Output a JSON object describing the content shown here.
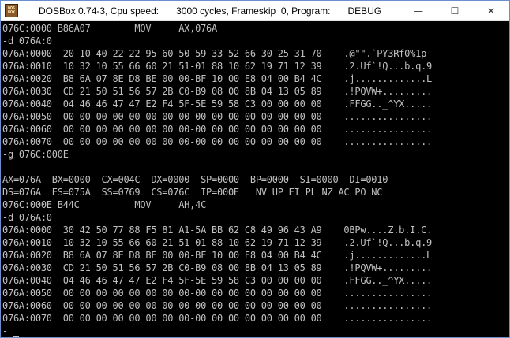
{
  "window": {
    "icon_label_top": "DOS",
    "icon_label_bottom": "BOX",
    "title_parts": [
      "DOSBox 0.74-3, Cpu speed:",
      "3000 cycles, Frameskip  0, Program:",
      "DEBUG"
    ],
    "controls": {
      "minimize": "—",
      "maximize": "☐",
      "close": "✕"
    }
  },
  "console": {
    "lines": [
      "076C:0000 B86A07        MOV     AX,076A",
      "-d 076A:0",
      "076A:0000  20 10 40 22 22 95 60 50-59 33 52 66 30 25 31 70    .@\"\".`PY3Rf0%1p",
      "076A:0010  10 32 10 55 66 60 21 51-01 88 10 62 19 71 12 39    .2.Uf`!Q...b.q.9",
      "076A:0020  B8 6A 07 8E D8 BE 00 00-BF 10 00 E8 04 00 B4 4C    .j.............L",
      "076A:0030  CD 21 50 51 56 57 2B C0-B9 08 00 8B 04 13 05 89    .!PQVW+.........",
      "076A:0040  04 46 46 47 47 E2 F4 5F-5E 59 58 C3 00 00 00 00    .FFGG.._^YX.....",
      "076A:0050  00 00 00 00 00 00 00 00-00 00 00 00 00 00 00 00    ................",
      "076A:0060  00 00 00 00 00 00 00 00-00 00 00 00 00 00 00 00    ................",
      "076A:0070  00 00 00 00 00 00 00 00-00 00 00 00 00 00 00 00    ................",
      "-g 076C:000E",
      "",
      "AX=076A  BX=0000  CX=004C  DX=0000  SP=0000  BP=0000  SI=0000  DI=0010",
      "DS=076A  ES=075A  SS=0769  CS=076C  IP=000E   NV UP EI PL NZ AC PO NC",
      "076C:000E B44C          MOV     AH,4C",
      "-d 076A:0",
      "076A:0000  30 42 50 77 88 F5 81 A1-5A BB 62 C8 49 96 43 A9    0BPw....Z.b.I.C.",
      "076A:0010  10 32 10 55 66 60 21 51-01 88 10 62 19 71 12 39    .2.Uf`!Q...b.q.9",
      "076A:0020  B8 6A 07 8E D8 BE 00 00-BF 10 00 E8 04 00 B4 4C    .j.............L",
      "076A:0030  CD 21 50 51 56 57 2B C0-B9 08 00 8B 04 13 05 89    .!PQVW+.........",
      "076A:0040  04 46 46 47 47 E2 F4 5F-5E 59 58 C3 00 00 00 00    .FFGG.._^YX.....",
      "076A:0050  00 00 00 00 00 00 00 00-00 00 00 00 00 00 00 00    ................",
      "076A:0060  00 00 00 00 00 00 00 00-00 00 00 00 00 00 00 00    ................",
      "076A:0070  00 00 00 00 00 00 00 00-00 00 00 00 00 00 00 00    ................"
    ],
    "prompt": "-",
    "colors": {
      "background": "#000000",
      "text": "#c0c0c0"
    }
  }
}
